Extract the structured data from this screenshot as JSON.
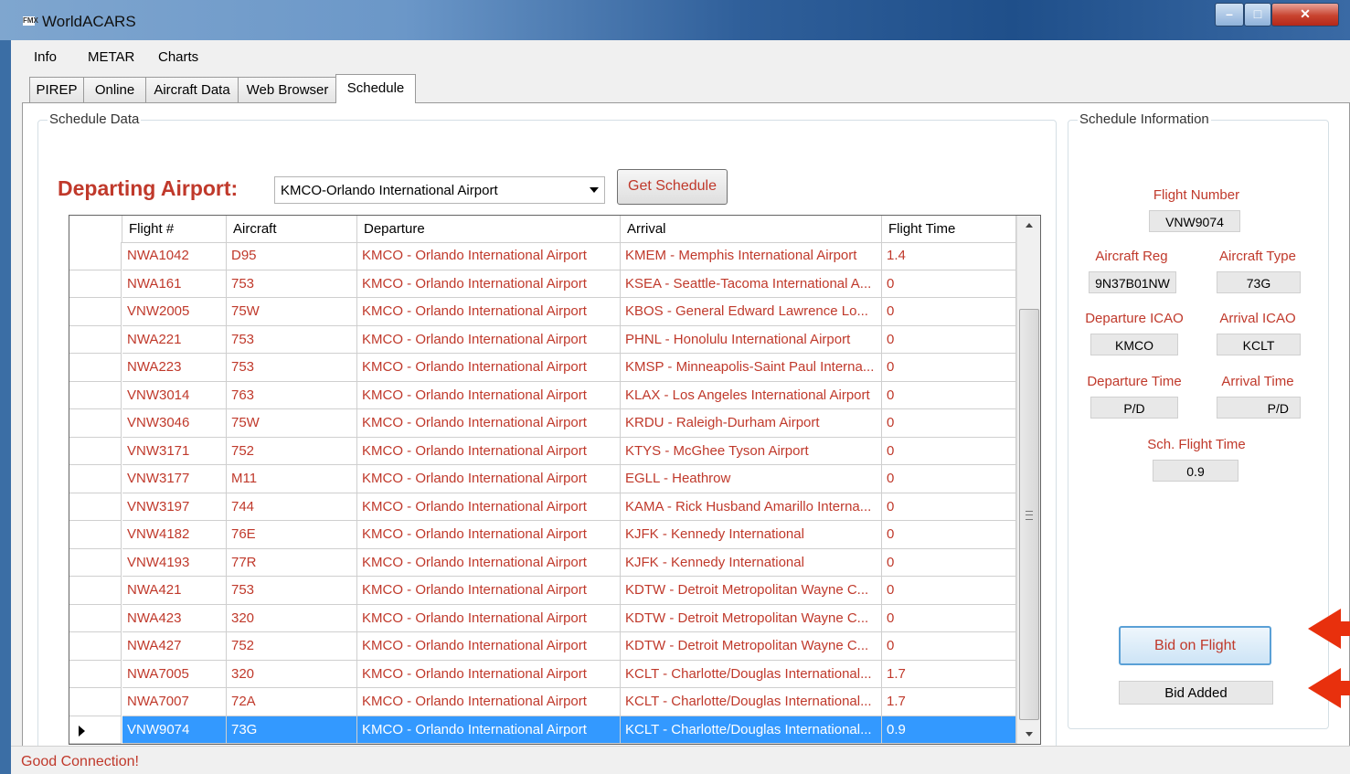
{
  "window": {
    "title": "WorldACARS",
    "app_icon": "FMX"
  },
  "menu": [
    "Info",
    "METAR",
    "Charts"
  ],
  "tabs": [
    "PIREP",
    "Online",
    "Aircraft Data",
    "Web Browser",
    "Schedule"
  ],
  "active_tab": "Schedule",
  "schedule": {
    "group_label": "Schedule Data",
    "departing_label": "Departing Airport:",
    "airport_value": "KMCO-Orlando International Airport",
    "get_schedule_label": "Get Schedule",
    "columns": [
      "Flight #",
      "Aircraft",
      "Departure",
      "Arrival",
      "Flight Time"
    ],
    "rows": [
      [
        "NWA1042",
        "D95",
        "KMCO - Orlando International Airport",
        "KMEM - Memphis International Airport",
        "1.4"
      ],
      [
        "NWA161",
        "753",
        "KMCO - Orlando International Airport",
        "KSEA - Seattle-Tacoma International A...",
        "0"
      ],
      [
        "VNW2005",
        "75W",
        "KMCO - Orlando International Airport",
        "KBOS - General Edward Lawrence Lo...",
        "0"
      ],
      [
        "NWA221",
        "753",
        "KMCO - Orlando International Airport",
        "PHNL - Honolulu International Airport",
        "0"
      ],
      [
        "NWA223",
        "753",
        "KMCO - Orlando International Airport",
        "KMSP - Minneapolis-Saint Paul Interna...",
        "0"
      ],
      [
        "VNW3014",
        "763",
        "KMCO - Orlando International Airport",
        "KLAX - Los Angeles International Airport",
        "0"
      ],
      [
        "VNW3046",
        "75W",
        "KMCO - Orlando International Airport",
        "KRDU - Raleigh-Durham Airport",
        "0"
      ],
      [
        "VNW3171",
        "752",
        "KMCO - Orlando International Airport",
        "KTYS - McGhee Tyson Airport",
        "0"
      ],
      [
        "VNW3177",
        "M11",
        "KMCO - Orlando International Airport",
        "EGLL - Heathrow",
        "0"
      ],
      [
        "VNW3197",
        "744",
        "KMCO - Orlando International Airport",
        "KAMA - Rick Husband Amarillo Interna...",
        "0"
      ],
      [
        "VNW4182",
        "76E",
        "KMCO - Orlando International Airport",
        "KJFK - Kennedy International",
        "0"
      ],
      [
        "VNW4193",
        "77R",
        "KMCO - Orlando International Airport",
        "KJFK - Kennedy International",
        "0"
      ],
      [
        "NWA421",
        "753",
        "KMCO - Orlando International Airport",
        "KDTW - Detroit Metropolitan Wayne C...",
        "0"
      ],
      [
        "NWA423",
        "320",
        "KMCO - Orlando International Airport",
        "KDTW - Detroit Metropolitan Wayne C...",
        "0"
      ],
      [
        "NWA427",
        "752",
        "KMCO - Orlando International Airport",
        "KDTW - Detroit Metropolitan Wayne C...",
        "0"
      ],
      [
        "NWA7005",
        "320",
        "KMCO - Orlando International Airport",
        "KCLT - Charlotte/Douglas International...",
        "1.7"
      ],
      [
        "NWA7007",
        "72A",
        "KMCO - Orlando International Airport",
        "KCLT - Charlotte/Douglas International...",
        "1.7"
      ],
      [
        "VNW9074",
        "73G",
        "KMCO - Orlando International Airport",
        "KCLT - Charlotte/Douglas International...",
        "0.9"
      ]
    ],
    "selected_row": 17
  },
  "info": {
    "group_label": "Schedule Information",
    "flight_number_label": "Flight Number",
    "flight_number": "VNW9074",
    "aircraft_reg_label": "Aircraft Reg",
    "aircraft_reg": "9N37B01NW",
    "aircraft_type_label": "Aircraft Type",
    "aircraft_type": "73G",
    "departure_icao_label": "Departure ICAO",
    "departure_icao": "KMCO",
    "arrival_icao_label": "Arrival ICAO",
    "arrival_icao": "KCLT",
    "departure_time_label": "Departure Time",
    "departure_time": "P/D",
    "arrival_time_label": "Arrival Time",
    "arrival_time": "P/D",
    "sch_flight_time_label": "Sch. Flight Time",
    "sch_flight_time": "0.9",
    "bid_button_label": "Bid on Flight",
    "bid_status": "Bid Added"
  },
  "status": {
    "text": "Good Connection!"
  },
  "colors": {
    "accent": "#c0392b",
    "selection": "#3399ff",
    "annotation_arrow": "#e8300d"
  }
}
